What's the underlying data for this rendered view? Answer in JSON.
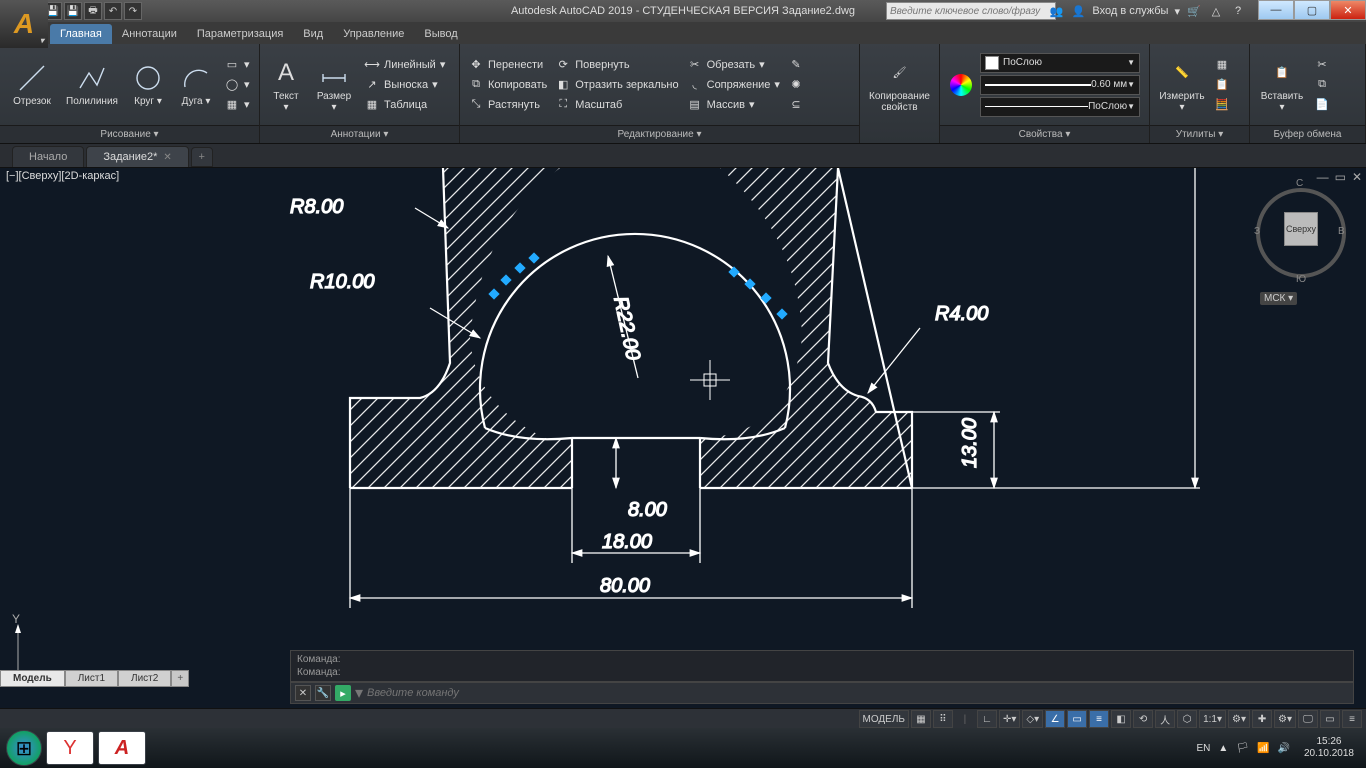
{
  "app": {
    "title": "Autodesk AutoCAD 2019 - СТУДЕНЧЕСКАЯ ВЕРСИЯ   Задание2.dwg",
    "search_placeholder": "Введите ключевое слово/фразу",
    "signin": "Вход в службы"
  },
  "ribtabs": [
    "Главная",
    "Аннотации",
    "Параметризация",
    "Вид",
    "Управление",
    "Вывод"
  ],
  "ribtab_active": 0,
  "panels": {
    "draw": {
      "title": "Рисование ▾",
      "otrezok": "Отрезок",
      "polyline": "Полилиния",
      "circle": "Круг",
      "arc": "Дуга"
    },
    "annot": {
      "title": "Аннотации ▾",
      "text": "Текст",
      "dim": "Размер",
      "linear": "Линейный",
      "leader": "Выноска",
      "table": "Таблица"
    },
    "modify": {
      "title": "Редактирование ▾",
      "move": "Перенести",
      "copy": "Копировать",
      "stretch": "Растянуть",
      "rotate": "Повернуть",
      "mirror": "Отразить зеркально",
      "scale": "Масштаб",
      "trim": "Обрезать",
      "fillet": "Сопряжение",
      "array": "Массив"
    },
    "clip": {
      "title": "Копирование свойств",
      "label": "Копирование\nсвойств"
    },
    "props": {
      "title": "Свойства ▾",
      "bylayer": "ПоСлою",
      "lineweight": "0.60 мм",
      "linetype": "ПоСлою"
    },
    "utils": {
      "title": "Утилиты ▾",
      "measure": "Измерить"
    },
    "clipboard": {
      "title": "Буфер обмена",
      "paste": "Вставить"
    }
  },
  "filetabs": {
    "home": "Начало",
    "active": "Задание2*"
  },
  "viewlabel": "[−][Сверху][2D-каркас]",
  "navcube": {
    "top": "Сверху",
    "n": "С",
    "s": "Ю",
    "e": "В",
    "w": "З",
    "wcs": "МСК ▾"
  },
  "drawing": {
    "r8": "R8.00",
    "r10": "R10.00",
    "r22": "R22.00",
    "r4": "R4.00",
    "d13": "13.00",
    "d8": "8.00",
    "d18": "18.00",
    "d80": "80.00"
  },
  "cmd": {
    "hist1": "Команда:",
    "hist2": "Команда:",
    "placeholder": "Введите команду"
  },
  "layouts": {
    "model": "Модель",
    "l1": "Лист1",
    "l2": "Лист2"
  },
  "status": {
    "model": "МОДЕЛЬ",
    "scale": "1:1"
  },
  "tray": {
    "lang": "EN",
    "time": "15:26",
    "date": "20.10.2018"
  }
}
